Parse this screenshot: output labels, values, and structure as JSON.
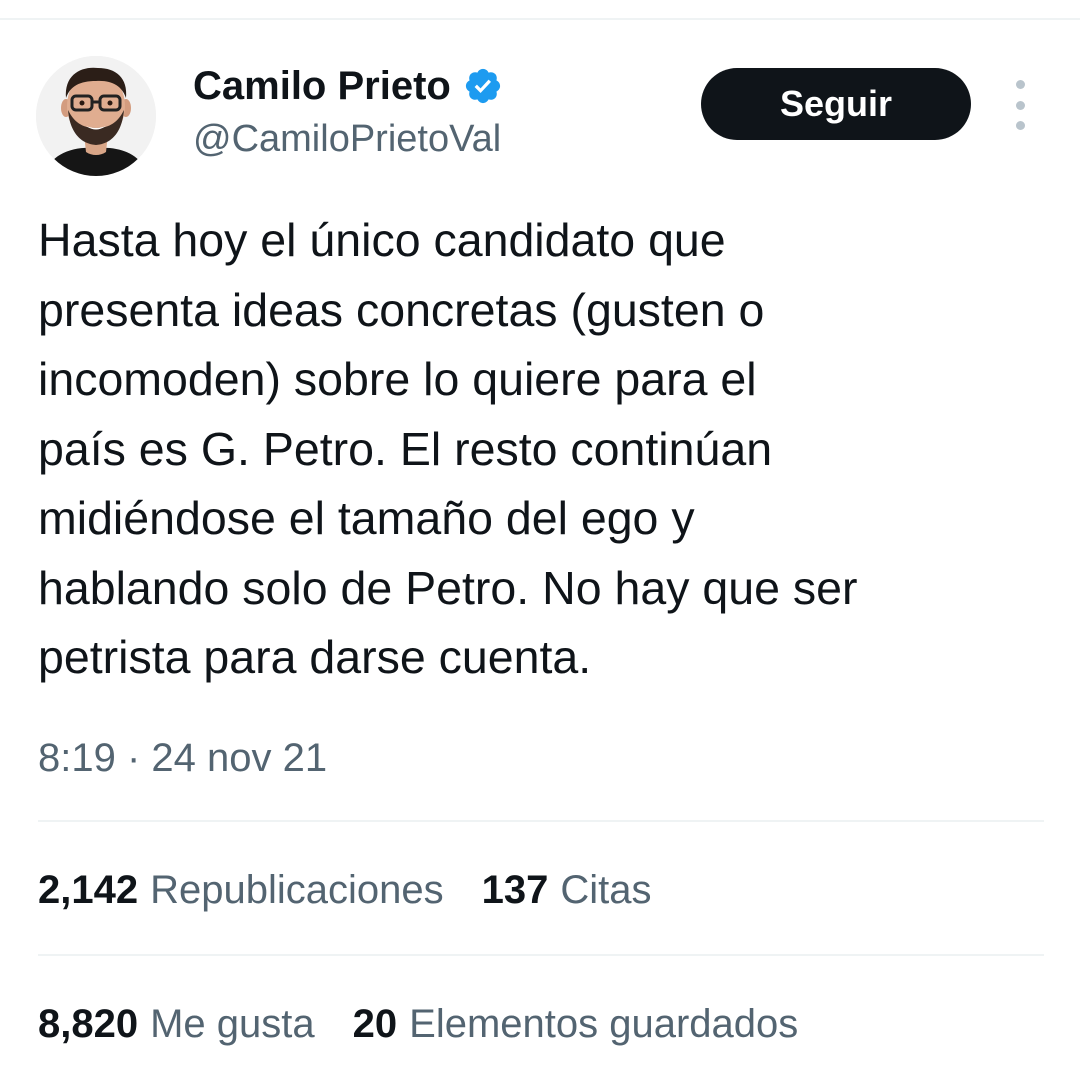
{
  "author": {
    "display_name": "Camilo Prieto",
    "handle": "@CamiloPrietoVal",
    "verified": true,
    "verified_badge_color": "#1d9bf0"
  },
  "actions": {
    "follow_label": "Seguir",
    "more_icon": "more-vertical-icon"
  },
  "tweet": {
    "text": "Hasta hoy el único candidato que\npresenta ideas concretas (gusten o\nincomoden) sobre lo quiere para el\npaís es G. Petro. El resto continúan\nmidiéndose el tamaño del ego y\nhablando solo de Petro. No hay que ser\npetrista para darse cuenta.",
    "timestamp": "8:19 · 24 nov 21"
  },
  "stats": {
    "reposts": {
      "count": "2,142",
      "label": "Republicaciones"
    },
    "quotes": {
      "count": "137",
      "label": "Citas"
    },
    "likes": {
      "count": "8,820",
      "label": "Me gusta"
    },
    "bookmarks": {
      "count": "20",
      "label": "Elementos guardados"
    }
  },
  "colors": {
    "text_primary": "#0f1419",
    "text_secondary": "#536471",
    "button_bg": "#0f1419",
    "divider": "#eff3f4"
  }
}
